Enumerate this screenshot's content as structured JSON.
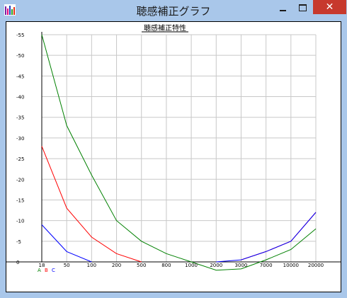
{
  "window": {
    "title": "聴感補正グラフ",
    "minimize_symbol": "—",
    "maximize_symbol": "□",
    "close_symbol": "✕",
    "app_icon": "bar-chart-icon",
    "close_color": "#c7392d",
    "frame_color": "#a9c7ea"
  },
  "chart_data": {
    "type": "line",
    "title": "聴感補正特性",
    "xlabel": "",
    "ylabel": "",
    "x_scale": "categorical",
    "categories": [
      "18",
      "50",
      "100",
      "200",
      "500",
      "800",
      "1000",
      "2000",
      "3000",
      "7000",
      "10000",
      "20000"
    ],
    "y_ticks": [
      "-55",
      "-50",
      "-45",
      "-40",
      "-35",
      "-30",
      "-25",
      "-20",
      "-15",
      "-10",
      "-5",
      "0"
    ],
    "ylim": [
      0,
      -55
    ],
    "y_inverted": true,
    "grid": true,
    "series": [
      {
        "name": "A",
        "color": "#008000",
        "values": [
          -55,
          -33,
          -21,
          -10,
          -5,
          -2,
          0,
          2,
          1.7,
          -0.5,
          -3,
          -8
        ]
      },
      {
        "name": "B",
        "color": "#ff0000",
        "values": [
          -28,
          -13,
          -6,
          -2,
          0,
          null,
          null,
          null,
          -0.5,
          -2.5,
          -5,
          -12
        ]
      },
      {
        "name": "C",
        "color": "#0000ff",
        "values": [
          -9,
          -2.5,
          0,
          null,
          null,
          null,
          null,
          0,
          -0.5,
          -2.5,
          -5,
          -12
        ]
      }
    ],
    "legend": [
      "A",
      "B",
      "C"
    ],
    "legend_position": "bottom-left"
  }
}
